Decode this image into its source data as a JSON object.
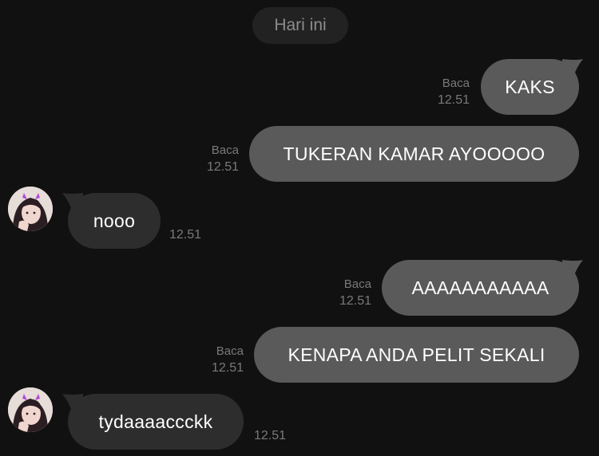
{
  "date_separator": "Hari ini",
  "messages": [
    {
      "direction": "out",
      "text": "KAKS",
      "read": "Baca",
      "time": "12.51"
    },
    {
      "direction": "out",
      "text": "TUKERAN KAMAR AYOOOOO",
      "read": "Baca",
      "time": "12.51"
    },
    {
      "direction": "in",
      "text": "nooo",
      "time": "12.51"
    },
    {
      "direction": "out",
      "text": "AAAAAAAAAAA",
      "read": "Baca",
      "time": "12.51"
    },
    {
      "direction": "out",
      "text": "KENAPA ANDA PELIT SEKALI",
      "read": "Baca",
      "time": "12.51"
    },
    {
      "direction": "in",
      "text": "tydaaaaccckk",
      "time": "12.51"
    }
  ],
  "colors": {
    "background": "#121112",
    "outgoing_bubble": "#5b5a5b",
    "incoming_bubble": "#2e2d2e",
    "meta_text": "#7a797a"
  }
}
